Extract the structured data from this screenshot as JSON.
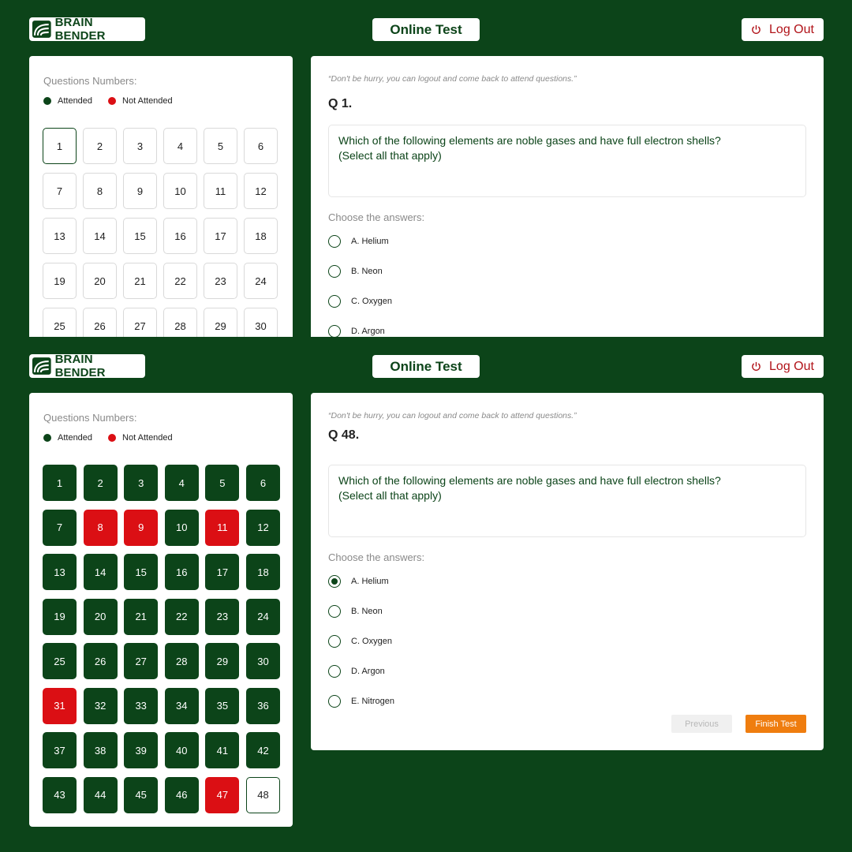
{
  "brand": {
    "name": "BRAIN BENDER"
  },
  "header": {
    "title": "Online Test",
    "logout_label": "Log Out"
  },
  "colors": {
    "green": "#0c4419",
    "red": "#db0f14",
    "orange": "#ef7d0f"
  },
  "icons": {
    "logo": "brain-bender-logo",
    "logout": "power-icon"
  },
  "top": {
    "questions_label": "Questions Numbers:",
    "legend": {
      "attended": "Attended",
      "not_attended": "Not Attended"
    },
    "cells": [
      {
        "n": "1",
        "state": "current"
      },
      {
        "n": "2",
        "state": "empty"
      },
      {
        "n": "3",
        "state": "empty"
      },
      {
        "n": "4",
        "state": "empty"
      },
      {
        "n": "5",
        "state": "empty"
      },
      {
        "n": "6",
        "state": "empty"
      },
      {
        "n": "7",
        "state": "empty"
      },
      {
        "n": "8",
        "state": "empty"
      },
      {
        "n": "9",
        "state": "empty"
      },
      {
        "n": "10",
        "state": "empty"
      },
      {
        "n": "11",
        "state": "empty"
      },
      {
        "n": "12",
        "state": "empty"
      },
      {
        "n": "13",
        "state": "empty"
      },
      {
        "n": "14",
        "state": "empty"
      },
      {
        "n": "15",
        "state": "empty"
      },
      {
        "n": "16",
        "state": "empty"
      },
      {
        "n": "17",
        "state": "empty"
      },
      {
        "n": "18",
        "state": "empty"
      },
      {
        "n": "19",
        "state": "empty"
      },
      {
        "n": "20",
        "state": "empty"
      },
      {
        "n": "21",
        "state": "empty"
      },
      {
        "n": "22",
        "state": "empty"
      },
      {
        "n": "23",
        "state": "empty"
      },
      {
        "n": "24",
        "state": "empty"
      },
      {
        "n": "25",
        "state": "empty"
      },
      {
        "n": "26",
        "state": "empty"
      },
      {
        "n": "27",
        "state": "empty"
      },
      {
        "n": "28",
        "state": "empty"
      },
      {
        "n": "29",
        "state": "empty"
      },
      {
        "n": "30",
        "state": "empty"
      }
    ],
    "quote": "“Don't be hurry, you can logout and come back to attend questions.”",
    "question_number": "Q 1.",
    "question_line1": "Which of the following elements are noble gases and have full electron shells?",
    "question_line2": "(Select all that apply)",
    "choose_label": "Choose the answers:",
    "options": [
      {
        "label": "A. Helium",
        "checked": false
      },
      {
        "label": "B. Neon",
        "checked": false
      },
      {
        "label": "C. Oxygen",
        "checked": false
      },
      {
        "label": "D. Argon",
        "checked": false
      }
    ]
  },
  "bottom": {
    "questions_label": "Questions Numbers:",
    "legend": {
      "attended": "Attended",
      "not_attended": "Not Attended"
    },
    "cells": [
      {
        "n": "1",
        "state": "att"
      },
      {
        "n": "2",
        "state": "att"
      },
      {
        "n": "3",
        "state": "att"
      },
      {
        "n": "4",
        "state": "att"
      },
      {
        "n": "5",
        "state": "att"
      },
      {
        "n": "6",
        "state": "att"
      },
      {
        "n": "7",
        "state": "att"
      },
      {
        "n": "8",
        "state": "nat"
      },
      {
        "n": "9",
        "state": "nat"
      },
      {
        "n": "10",
        "state": "att"
      },
      {
        "n": "11",
        "state": "nat"
      },
      {
        "n": "12",
        "state": "att"
      },
      {
        "n": "13",
        "state": "att"
      },
      {
        "n": "14",
        "state": "att"
      },
      {
        "n": "15",
        "state": "att"
      },
      {
        "n": "16",
        "state": "att"
      },
      {
        "n": "17",
        "state": "att"
      },
      {
        "n": "18",
        "state": "att"
      },
      {
        "n": "19",
        "state": "att"
      },
      {
        "n": "20",
        "state": "att"
      },
      {
        "n": "21",
        "state": "att"
      },
      {
        "n": "22",
        "state": "att"
      },
      {
        "n": "23",
        "state": "att"
      },
      {
        "n": "24",
        "state": "att"
      },
      {
        "n": "25",
        "state": "att"
      },
      {
        "n": "26",
        "state": "att"
      },
      {
        "n": "27",
        "state": "att"
      },
      {
        "n": "28",
        "state": "att"
      },
      {
        "n": "29",
        "state": "att"
      },
      {
        "n": "30",
        "state": "att"
      },
      {
        "n": "31",
        "state": "nat"
      },
      {
        "n": "32",
        "state": "att"
      },
      {
        "n": "33",
        "state": "att"
      },
      {
        "n": "34",
        "state": "att"
      },
      {
        "n": "35",
        "state": "att"
      },
      {
        "n": "36",
        "state": "att"
      },
      {
        "n": "37",
        "state": "att"
      },
      {
        "n": "38",
        "state": "att"
      },
      {
        "n": "39",
        "state": "att"
      },
      {
        "n": "40",
        "state": "att"
      },
      {
        "n": "41",
        "state": "att"
      },
      {
        "n": "42",
        "state": "att"
      },
      {
        "n": "43",
        "state": "att"
      },
      {
        "n": "44",
        "state": "att"
      },
      {
        "n": "45",
        "state": "att"
      },
      {
        "n": "46",
        "state": "att"
      },
      {
        "n": "47",
        "state": "nat"
      },
      {
        "n": "48",
        "state": "current"
      }
    ],
    "quote": "“Don't be hurry, you can logout and come back to attend questions.”",
    "question_number": "Q 48.",
    "question_line1": "Which of the following elements are noble gases and have full electron shells?",
    "question_line2": "(Select all that apply)",
    "choose_label": "Choose the answers:",
    "options": [
      {
        "label": "A. Helium",
        "checked": true
      },
      {
        "label": "B. Neon",
        "checked": false
      },
      {
        "label": "C. Oxygen",
        "checked": false
      },
      {
        "label": "D. Argon",
        "checked": false
      },
      {
        "label": "E. Nitrogen",
        "checked": false
      }
    ],
    "prev_label": "Previous",
    "finish_label": "Finish Test"
  }
}
